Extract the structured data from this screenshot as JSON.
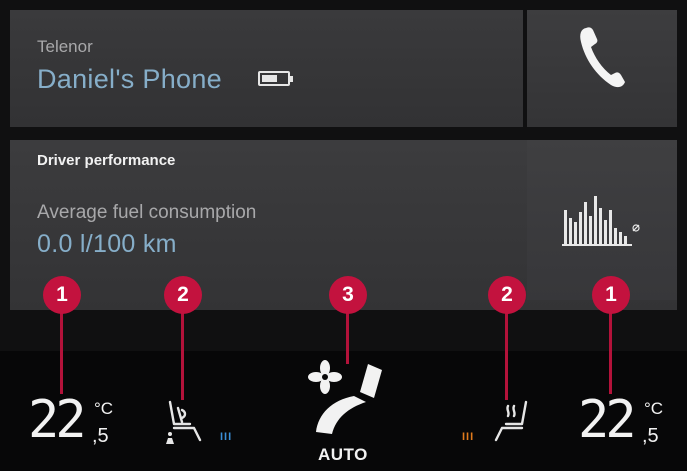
{
  "phone": {
    "carrier": "Telenor",
    "device_name": "Daniel's Phone",
    "battery_icon": "battery-icon",
    "button_icon": "phone-handset-icon"
  },
  "driver_performance": {
    "title": "Driver performance",
    "metric_label": "Average fuel consumption",
    "metric_value": "0.0 l/100 km",
    "icon": "bar-chart-icon"
  },
  "climate": {
    "left_temp": {
      "whole": "22",
      "unit": "°C",
      "decimal": ",5"
    },
    "right_temp": {
      "whole": "22",
      "unit": "°C",
      "decimal": ",5"
    },
    "left_seat": {
      "icon": "seat-ventilation-icon",
      "level_text": "III",
      "level_color": "#3a8fd8"
    },
    "right_seat": {
      "icon": "seat-heating-icon",
      "level_text": "III",
      "level_color": "#e07a1c"
    },
    "center": {
      "label": "AUTO",
      "icons": [
        "fan-icon",
        "airflow-icon"
      ]
    }
  },
  "callouts": [
    "1",
    "2",
    "3",
    "2",
    "1"
  ],
  "colors": {
    "accent_blue": "#86aec9",
    "callout_red": "#c3123e",
    "tile_gray": "#38383a",
    "background": "#101011"
  }
}
